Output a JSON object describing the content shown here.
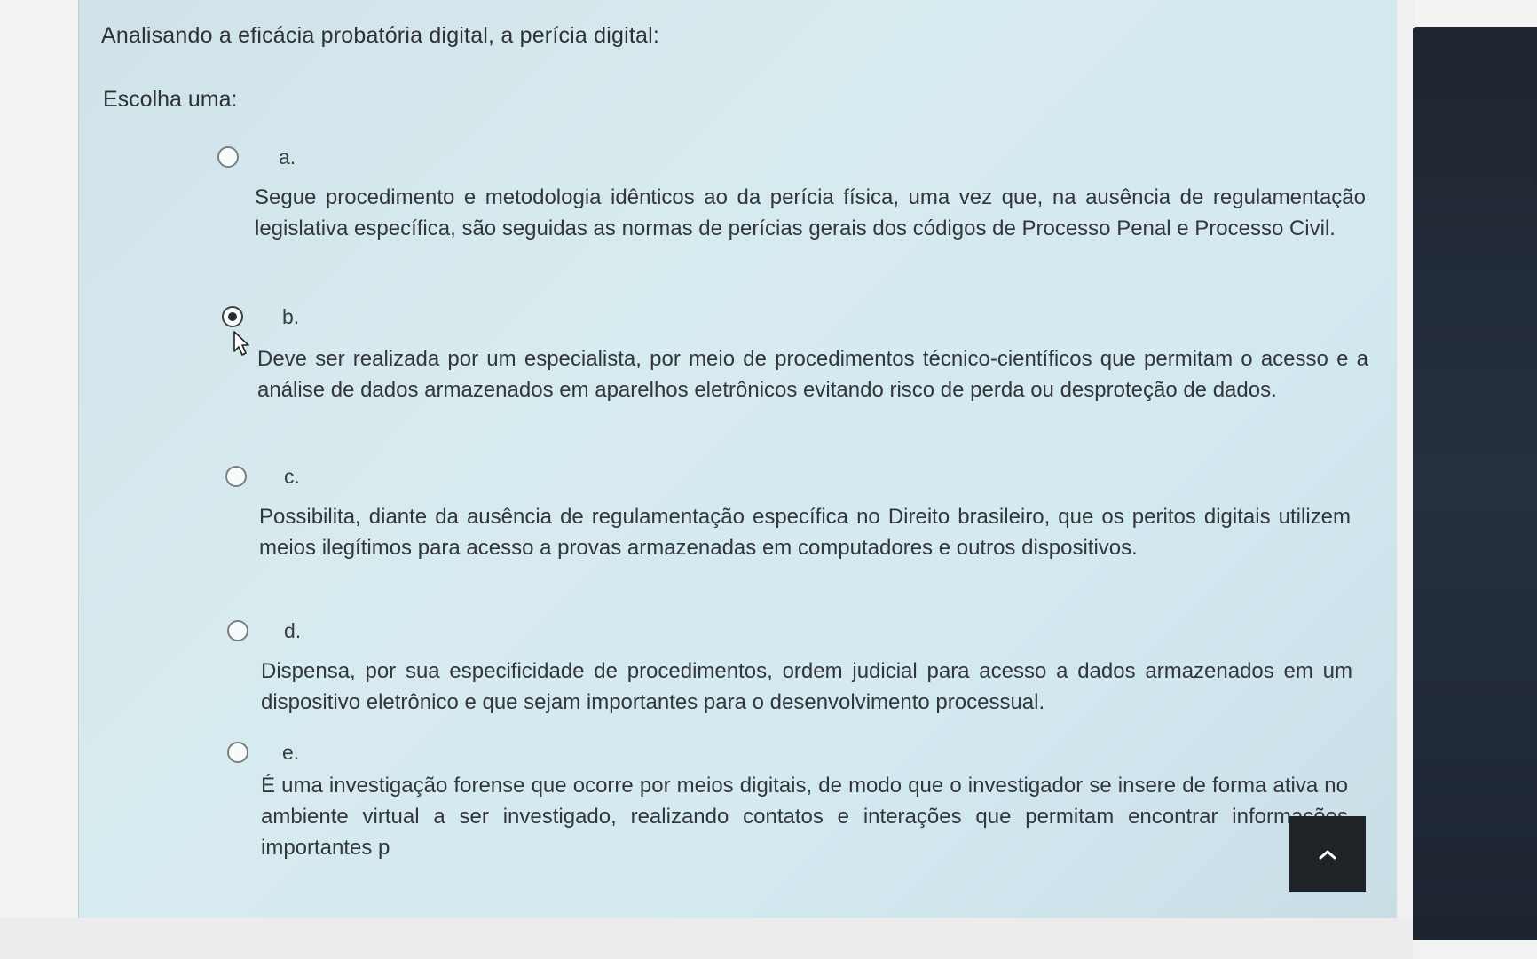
{
  "question": {
    "text": "Analisando a eficácia probatória digital, a perícia digital:",
    "prompt": "Escolha uma:"
  },
  "options": [
    {
      "letter": "a.",
      "text": "Segue procedimento e metodologia idênticos ao da perícia física, uma vez que, na ausência de regulamentação legislativa específica, são seguidas as normas de perícias gerais dos códigos de Processo Penal e Processo Civil.",
      "selected": false
    },
    {
      "letter": "b.",
      "text": "Deve ser realizada por um especialista, por meio de procedimentos técnico-científicos que permitam o acesso e a análise de dados armazenados em aparelhos eletrônicos evitando risco de perda ou desproteção de dados.",
      "selected": true
    },
    {
      "letter": "c.",
      "text": "Possibilita, diante da ausência de regulamentação específica no Direito brasileiro, que os peritos digitais utilizem meios ilegítimos para acesso a provas armazenadas em computadores e outros dispositivos.",
      "selected": false
    },
    {
      "letter": "d.",
      "text": "Dispensa, por sua especificidade de procedimentos, ordem judicial para acesso a dados armazenados em um dispositivo eletrônico e que sejam importantes para o desenvolvimento processual.",
      "selected": false
    },
    {
      "letter": "e.",
      "text": "É uma investigação forense que ocorre por meios digitais, de modo que o investigador se insere de forma ativa no ambiente virtual a ser investigado, realizando contatos e interações que permitam encontrar informações importantes p",
      "selected": false
    }
  ],
  "scroll_top": {
    "icon": "chevron-up-icon"
  },
  "colors": {
    "panel": "#d3e8ee",
    "text": "#33363a",
    "button": "#1f2328",
    "sidebar": "#222b37"
  }
}
